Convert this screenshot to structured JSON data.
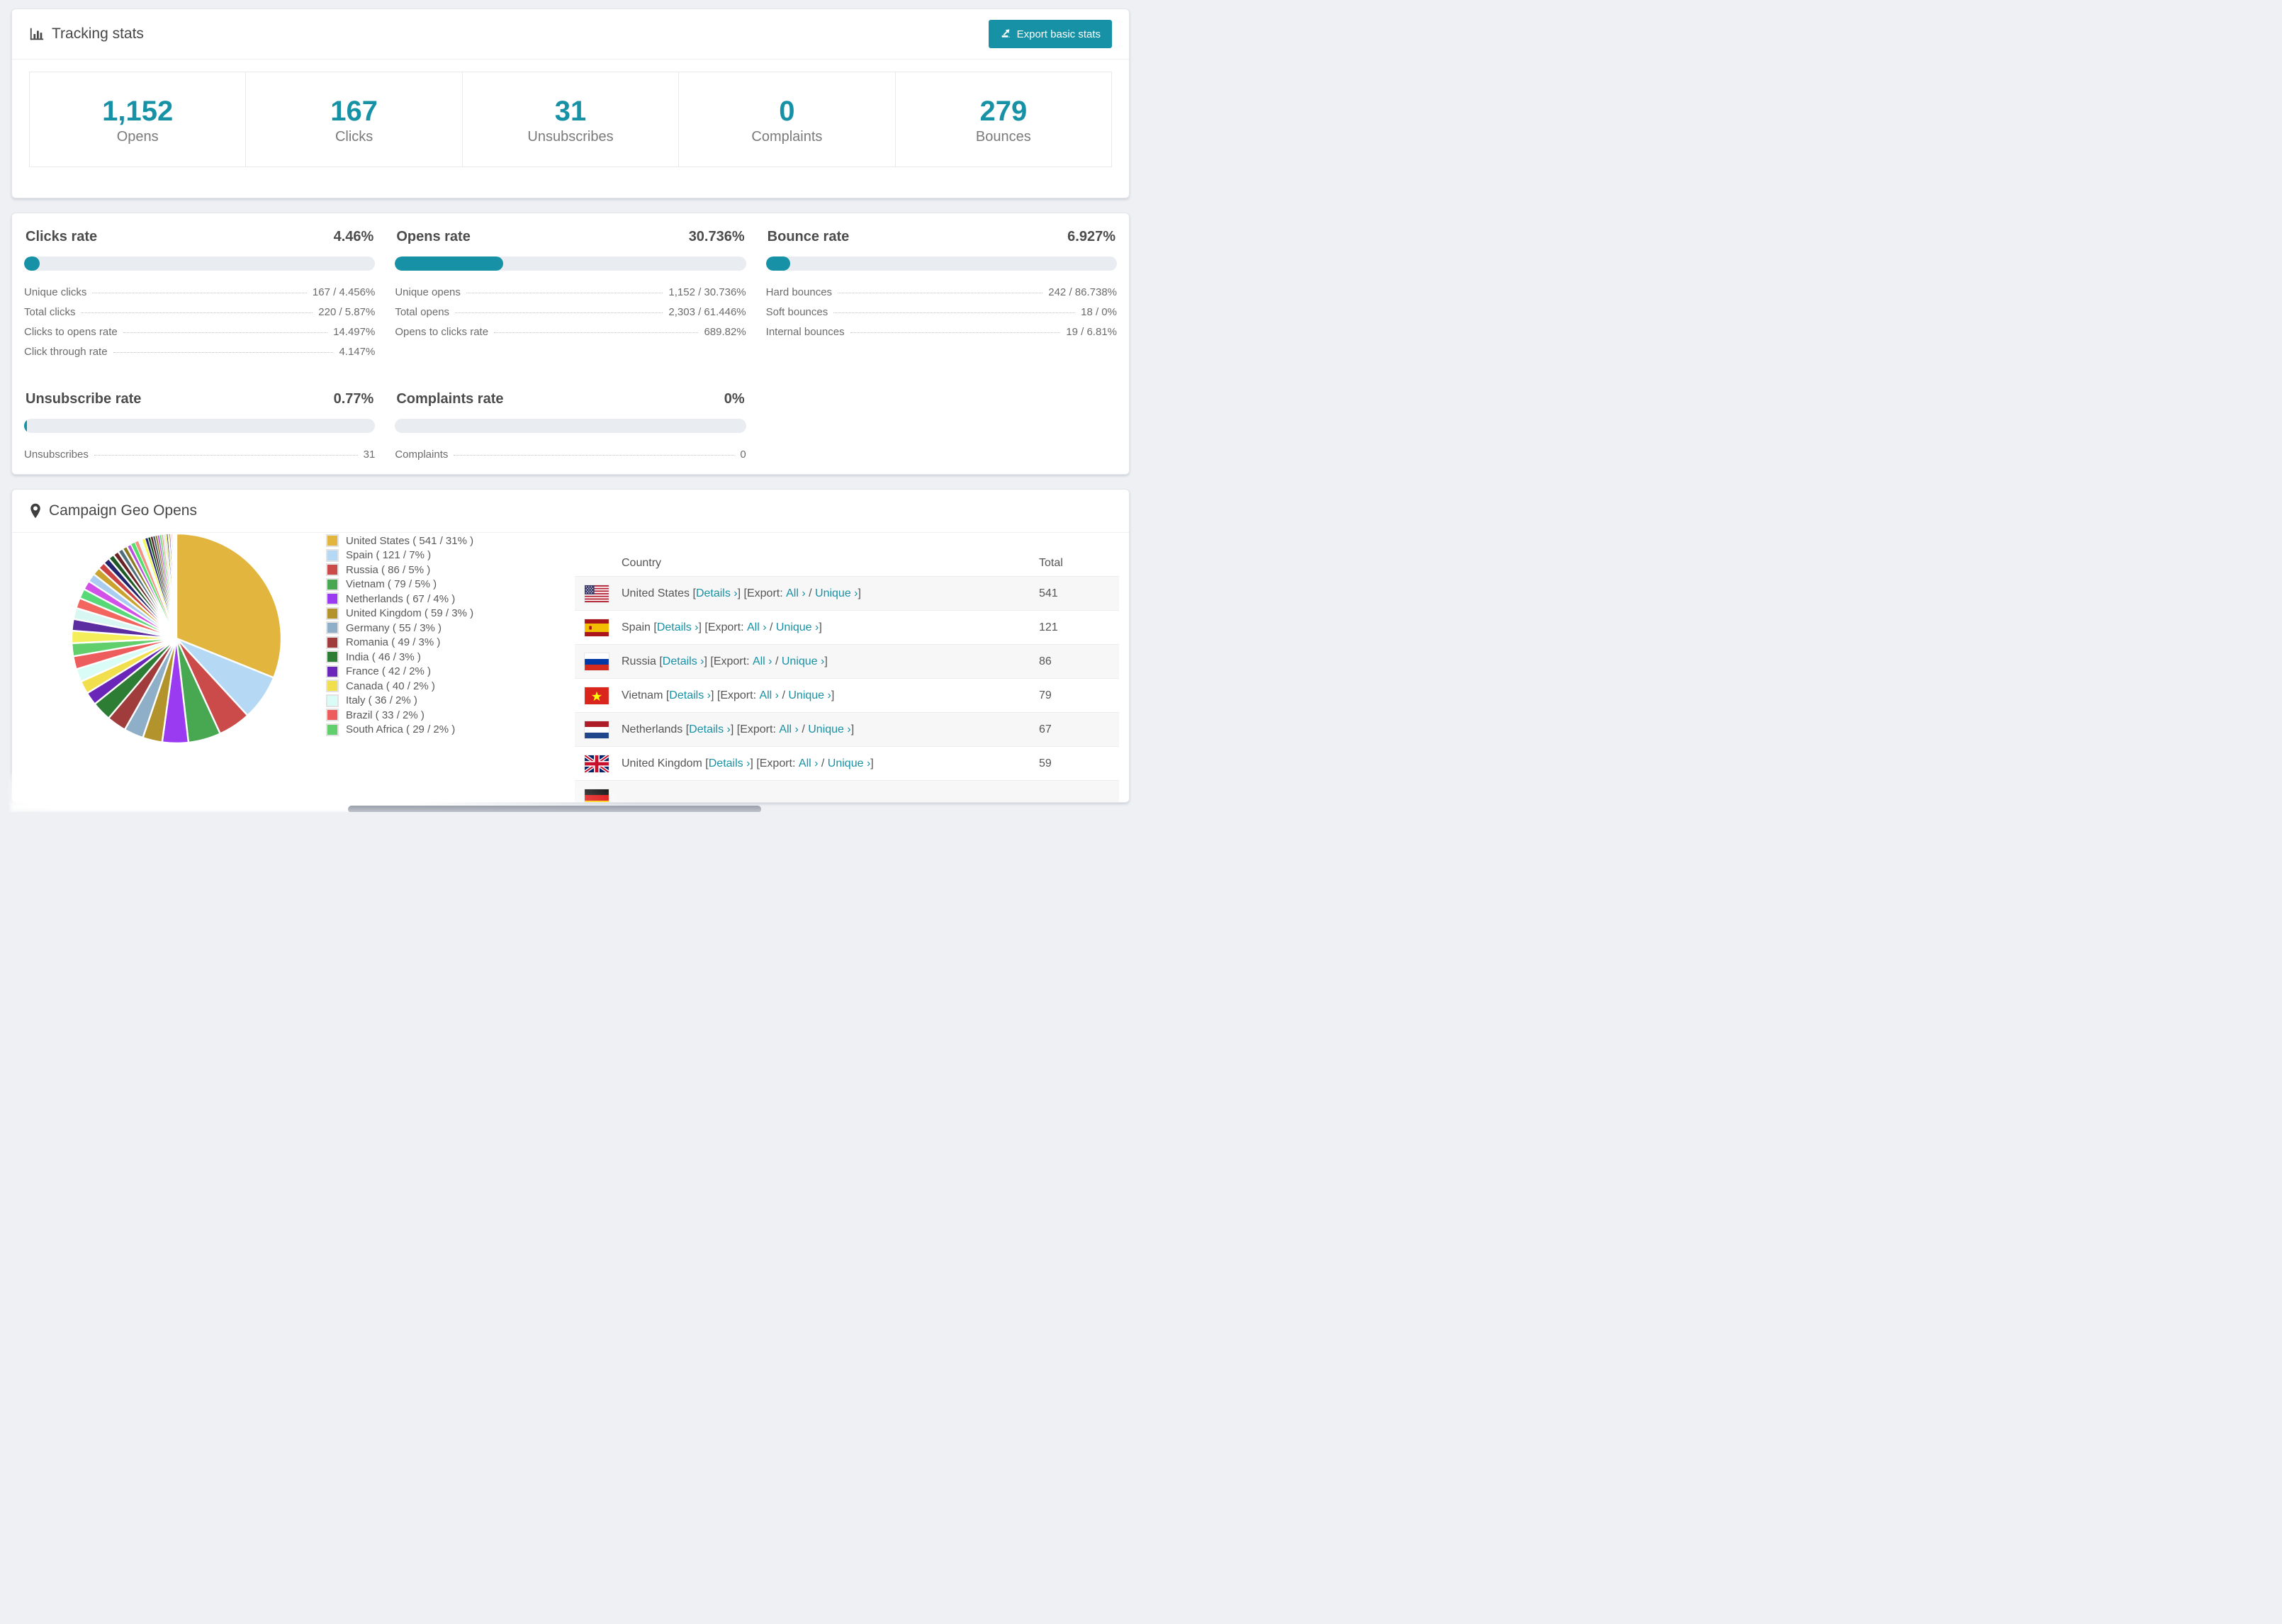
{
  "theme": {
    "accent": "#1791a5",
    "track": "#e9ecf0",
    "card_border": "#e2e5e9",
    "text_dark": "#474747",
    "text_gray": "#7a7a7a"
  },
  "tracking": {
    "title": "Tracking stats",
    "export_label": "Export basic stats",
    "stats": [
      {
        "value": "1,152",
        "label": "Opens"
      },
      {
        "value": "167",
        "label": "Clicks"
      },
      {
        "value": "31",
        "label": "Unsubscribes"
      },
      {
        "value": "0",
        "label": "Complaints"
      },
      {
        "value": "279",
        "label": "Bounces"
      }
    ]
  },
  "rates": [
    {
      "title": "Clicks rate",
      "value": "4.46%",
      "percent": 4.46,
      "rows": [
        {
          "label": "Unique clicks",
          "value": "167 / 4.456%"
        },
        {
          "label": "Total clicks",
          "value": "220 / 5.87%"
        },
        {
          "label": "Clicks to opens rate",
          "value": "14.497%"
        },
        {
          "label": "Click through rate",
          "value": "4.147%"
        }
      ]
    },
    {
      "title": "Opens rate",
      "value": "30.736%",
      "percent": 30.736,
      "rows": [
        {
          "label": "Unique opens",
          "value": "1,152 / 30.736%"
        },
        {
          "label": "Total opens",
          "value": "2,303 / 61.446%"
        },
        {
          "label": "Opens to clicks rate",
          "value": "689.82%"
        }
      ]
    },
    {
      "title": "Bounce rate",
      "value": "6.927%",
      "percent": 6.927,
      "rows": [
        {
          "label": "Hard bounces",
          "value": "242 / 86.738%"
        },
        {
          "label": "Soft bounces",
          "value": "18 / 0%"
        },
        {
          "label": "Internal bounces",
          "value": "19 / 6.81%"
        }
      ]
    },
    {
      "title": "Unsubscribe rate",
      "value": "0.77%",
      "percent": 0.77,
      "rows": [
        {
          "label": "Unsubscribes",
          "value": "31"
        }
      ]
    },
    {
      "title": "Complaints rate",
      "value": "0%",
      "percent": 0,
      "rows": [
        {
          "label": "Complaints",
          "value": "0"
        }
      ]
    }
  ],
  "geo": {
    "title": "Campaign Geo Opens",
    "table": {
      "columns": [
        "Country",
        "Total"
      ],
      "link_labels": {
        "details": "Details ›",
        "all": "All ›",
        "unique": "Unique ›",
        "export_prefix": "Export: "
      },
      "rows": [
        {
          "country": "United States",
          "total": "541",
          "flag": "us",
          "partial": false
        },
        {
          "country": "Spain",
          "total": "121",
          "flag": "es",
          "partial": false
        },
        {
          "country": "Russia",
          "total": "86",
          "flag": "ru",
          "partial": false
        },
        {
          "country": "Vietnam",
          "total": "79",
          "flag": "vn",
          "partial": false
        },
        {
          "country": "Netherlands",
          "total": "67",
          "flag": "nl",
          "partial": false
        },
        {
          "country": "United Kingdom",
          "total": "59",
          "flag": "gb",
          "partial": false
        },
        {
          "country": "",
          "total": "",
          "flag": "de",
          "partial": true
        }
      ]
    }
  },
  "chart_data": {
    "type": "pie",
    "title": "Campaign Geo Opens",
    "legend_position": "right",
    "start_angle_deg": -90,
    "direction": "clockwise",
    "series": [
      {
        "label": "United States ( 541 / 31% )",
        "name": "United States",
        "value": 541,
        "pct": 31,
        "color": "#e2b53e"
      },
      {
        "label": "Spain ( 121 / 7% )",
        "name": "Spain",
        "value": 121,
        "pct": 7,
        "color": "#b5d9f5"
      },
      {
        "label": "Russia ( 86 / 5% )",
        "name": "Russia",
        "value": 86,
        "pct": 5,
        "color": "#cb4a4a"
      },
      {
        "label": "Vietnam ( 79 / 5% )",
        "name": "Vietnam",
        "value": 79,
        "pct": 5,
        "color": "#48a852"
      },
      {
        "label": "Netherlands ( 67 / 4% )",
        "name": "Netherlands",
        "value": 67,
        "pct": 4,
        "color": "#9a3bf2"
      },
      {
        "label": "United Kingdom ( 59 / 3% )",
        "name": "United Kingdom",
        "value": 59,
        "pct": 3,
        "color": "#b3932c"
      },
      {
        "label": "Germany ( 55 / 3% )",
        "name": "Germany",
        "value": 55,
        "pct": 3,
        "color": "#8fafc9"
      },
      {
        "label": "Romania ( 49 / 3% )",
        "name": "Romania",
        "value": 49,
        "pct": 3,
        "color": "#a03c3c"
      },
      {
        "label": "India ( 46 / 3% )",
        "name": "India",
        "value": 46,
        "pct": 3,
        "color": "#2e7d35"
      },
      {
        "label": "France ( 42 / 2% )",
        "name": "France",
        "value": 42,
        "pct": 2,
        "color": "#6a26b8"
      },
      {
        "label": "Canada ( 40 / 2% )",
        "name": "Canada",
        "value": 40,
        "pct": 2,
        "color": "#f2df4e"
      },
      {
        "label": "Italy ( 36 / 2% )",
        "name": "Italy",
        "value": 36,
        "pct": 2,
        "color": "#d9fcf6"
      },
      {
        "label": "Brazil ( 33 / 2% )",
        "name": "Brazil",
        "value": 33,
        "pct": 2,
        "color": "#ee5d5d"
      },
      {
        "label": "South Africa ( 29 / 2% )",
        "name": "South Africa",
        "value": 29,
        "pct": 2,
        "color": "#61cf6b"
      }
    ],
    "others_pct_values": [
      1.9,
      1.8,
      1.7,
      1.6,
      1.5,
      1.4,
      1.3,
      1.2,
      1.1,
      1.0,
      0.9,
      0.85,
      0.8,
      0.75,
      0.7,
      0.65,
      0.6,
      0.55,
      0.5,
      0.45,
      0.4,
      0.38,
      0.36,
      0.34,
      0.32,
      0.3,
      0.28,
      0.26,
      0.24,
      0.22,
      0.2,
      0.18,
      0.16,
      0.14,
      0.12,
      0.1,
      0.09,
      0.08,
      0.07,
      0.06,
      0.05,
      0.04
    ],
    "others_palette": [
      "#f4ee5a",
      "#5b2da0",
      "#d8f7f3",
      "#f2665f",
      "#57d977",
      "#d24fe8",
      "#a9cdf0",
      "#caa22e",
      "#cc4343",
      "#24246e",
      "#1d5a26",
      "#6b2222",
      "#4e6e7e",
      "#8a7a22",
      "#b84fe0",
      "#53e06a",
      "#f59282",
      "#eefcff",
      "#f7f75a",
      "#27276e",
      "#114f1c",
      "#5c1f1f",
      "#3f5f6f",
      "#958222",
      "#c050e8",
      "#4fe066",
      "#f2a090",
      "#cfe8f8",
      "#e8e84f",
      "#2d2d7a"
    ]
  }
}
